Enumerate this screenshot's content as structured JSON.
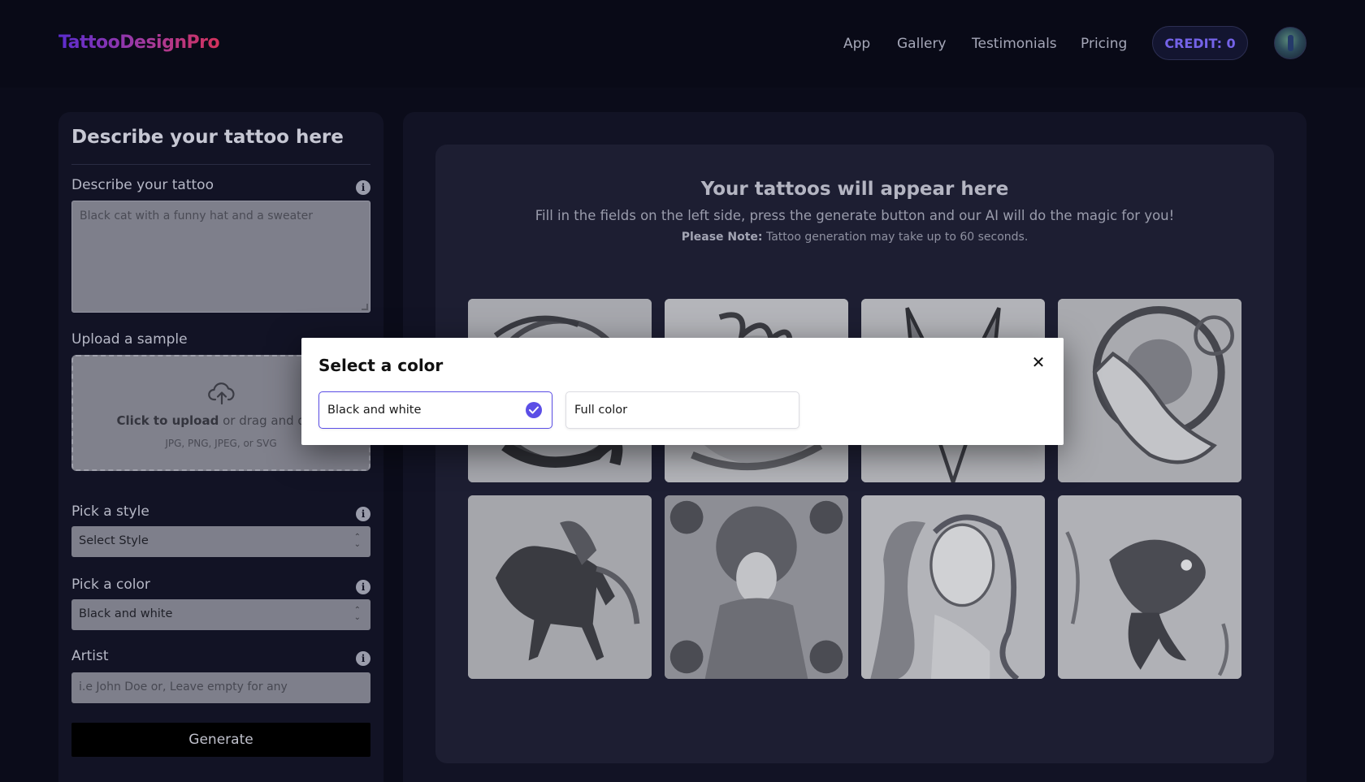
{
  "header": {
    "logo": "TattooDesignPro",
    "nav": [
      "App",
      "Gallery",
      "Testimonials",
      "Pricing"
    ],
    "credit": "CREDIT: 0"
  },
  "form": {
    "title": "Describe your tattoo here",
    "describe_label": "Describe your tattoo",
    "describe_placeholder": "Black cat with a funny hat and a sweater",
    "upload_label": "Upload a sample",
    "upload_click": "Click to upload",
    "upload_drag": " or drag and drop",
    "upload_types": "JPG, PNG, JPEG, or SVG",
    "style_label": "Pick a style",
    "style_value": "Select Style",
    "color_label": "Pick a color",
    "color_value": "Black and white",
    "artist_label": "Artist",
    "artist_placeholder": "i.e John Doe or, Leave empty for any",
    "generate": "Generate"
  },
  "results": {
    "title": "Your tattoos will appear here",
    "subtitle": "Fill in the fields on the left side, press the generate button and our AI will do the magic for you!",
    "note_label": "Please Note:",
    "note_text": " Tattoo generation may take up to 60 seconds."
  },
  "modal": {
    "title": "Select a color",
    "options": [
      "Black and white",
      "Full color"
    ],
    "selected": "Black and white"
  }
}
